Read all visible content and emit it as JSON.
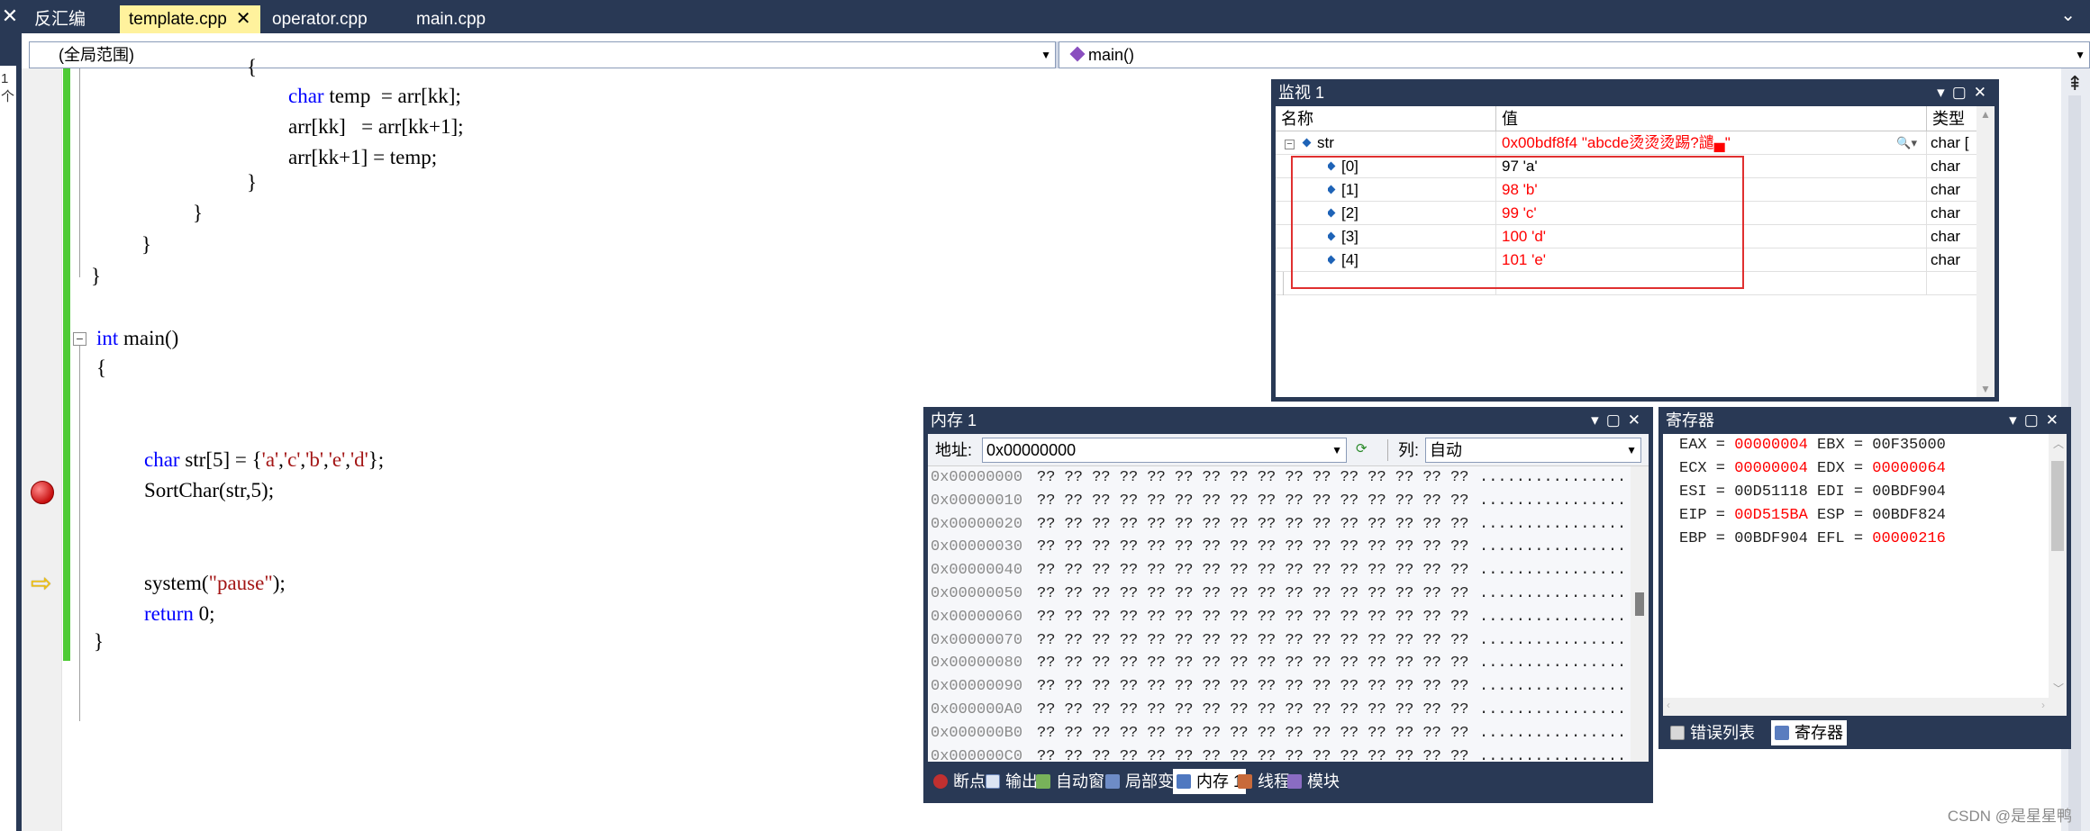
{
  "tabs": {
    "items": [
      {
        "label": "反汇编"
      },
      {
        "label": "template.cpp",
        "active": true
      },
      {
        "label": "operator.cpp"
      },
      {
        "label": "main.cpp"
      }
    ],
    "close_glyph": "✕"
  },
  "left_strip": {
    "text": "1 个"
  },
  "navbar": {
    "scope": "(全局范围)",
    "function": "main()"
  },
  "code": {
    "lines": [
      {
        "text": "{"
      },
      {
        "kw": "char",
        "text": " temp  = arr[kk];"
      },
      {
        "text": "arr[kk]   = arr[kk+1];"
      },
      {
        "text": "arr[kk+1] = temp;"
      },
      {
        "text": "}"
      },
      {
        "text": "}"
      },
      {
        "text": "}"
      },
      {
        "text": "}"
      },
      {
        "kw": "int",
        "text": " main()"
      },
      {
        "text": "{"
      },
      {
        "kw": "char",
        "pre": " str[5] = {",
        "str_parts": [
          "'a'",
          "'c'",
          "'b'",
          "'e'",
          "'d'"
        ],
        "post": "};"
      },
      {
        "text": "SortChar(str,5);"
      },
      {
        "pre": "system(",
        "str": "\"pause\"",
        "post": ");"
      },
      {
        "kw": "return",
        "text": " 0;"
      },
      {
        "text": "}"
      }
    ]
  },
  "watch": {
    "title": "监视 1",
    "headers": {
      "name": "名称",
      "value": "值",
      "type": "类型"
    },
    "rows": [
      {
        "name": "str",
        "value": "0x00bdf8f4 \"abcde烫烫烫踢?譴▄\"",
        "type": "char [",
        "expanded": true
      },
      {
        "name": "[0]",
        "value": "97 'a'",
        "type": "char"
      },
      {
        "name": "[1]",
        "value": "98 'b'",
        "type": "char"
      },
      {
        "name": "[2]",
        "value": "99 'c'",
        "type": "char"
      },
      {
        "name": "[3]",
        "value": "100 'd'",
        "type": "char"
      },
      {
        "name": "[4]",
        "value": "101 'e'",
        "type": "char"
      }
    ],
    "colors": {
      "changed": "#ff0000"
    }
  },
  "memory": {
    "title": "内存 1",
    "address_label": "地址:",
    "address_value": "0x00000000",
    "columns_label": "列:",
    "columns_value": "自动",
    "rows": [
      {
        "addr": "0x00000000"
      },
      {
        "addr": "0x00000010"
      },
      {
        "addr": "0x00000020"
      },
      {
        "addr": "0x00000030"
      },
      {
        "addr": "0x00000040"
      },
      {
        "addr": "0x00000050"
      },
      {
        "addr": "0x00000060"
      },
      {
        "addr": "0x00000070"
      },
      {
        "addr": "0x00000080"
      },
      {
        "addr": "0x00000090"
      },
      {
        "addr": "0x000000A0"
      },
      {
        "addr": "0x000000B0"
      },
      {
        "addr": "0x000000C0"
      }
    ],
    "bytes_text": "?? ?? ?? ?? ?? ?? ?? ?? ?? ?? ?? ?? ?? ?? ?? ??",
    "ascii_text": "................"
  },
  "bottom_tabs": [
    {
      "label": "断点",
      "icon": "breakpoint-icon"
    },
    {
      "label": "输出",
      "icon": "output-icon"
    },
    {
      "label": "自动窗口",
      "icon": "autos-icon"
    },
    {
      "label": "局部变量",
      "icon": "locals-icon"
    },
    {
      "label": "内存 1",
      "icon": "memory-icon",
      "active": true
    },
    {
      "label": "线程",
      "icon": "threads-icon"
    },
    {
      "label": "模块",
      "icon": "modules-icon"
    }
  ],
  "registers": {
    "title": "寄存器",
    "lines": [
      [
        {
          "t": "EAX = "
        },
        {
          "t": "00000004",
          "changed": true
        },
        {
          "t": " EBX = 00F35000"
        }
      ],
      [
        {
          "t": "ECX = "
        },
        {
          "t": "00000004",
          "changed": true
        },
        {
          "t": " EDX = "
        },
        {
          "t": "00000064",
          "changed": true
        }
      ],
      [
        {
          "t": "ESI = 00D51118 EDI = 00BDF904"
        }
      ],
      [
        {
          "t": "EIP = "
        },
        {
          "t": "00D515BA",
          "changed": true
        },
        {
          "t": " ESP = 00BDF824"
        }
      ],
      [
        {
          "t": "EBP = 00BDF904 EFL = "
        },
        {
          "t": "00000216",
          "changed": true
        }
      ]
    ],
    "tabs": [
      {
        "label": "错误列表",
        "icon": "error-list-icon"
      },
      {
        "label": "寄存器",
        "icon": "registers-icon",
        "active": true
      }
    ]
  },
  "watermark": "CSDN @是星星鸭"
}
